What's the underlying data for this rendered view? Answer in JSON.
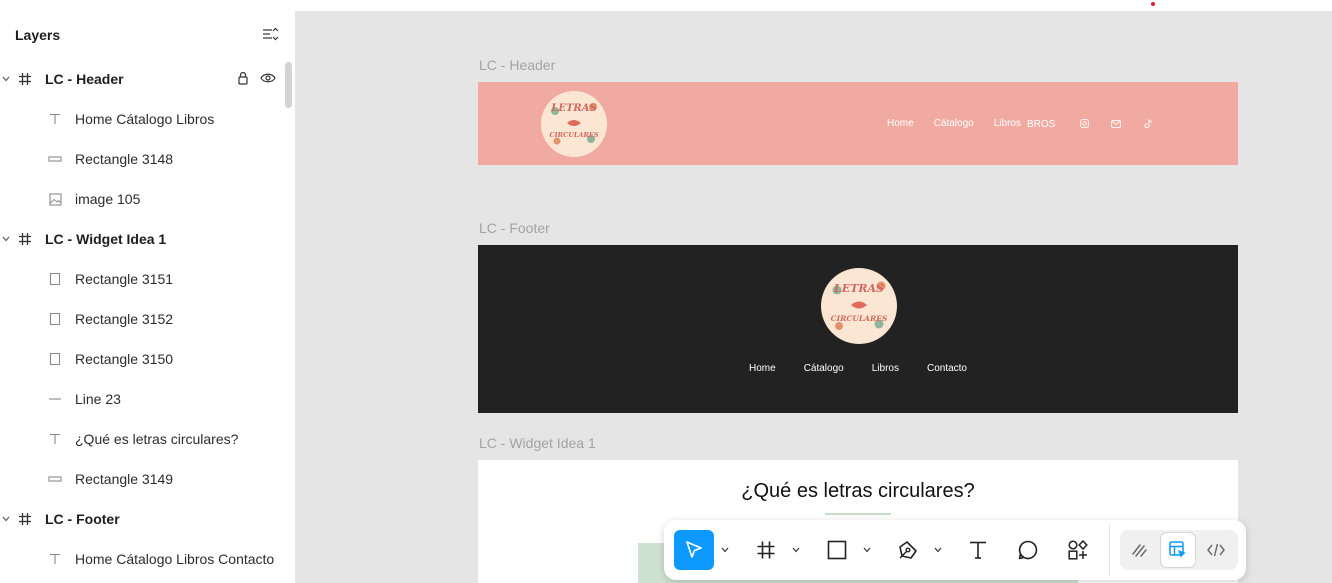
{
  "panel": {
    "title": "Layers",
    "layers": [
      {
        "label": "LC - Header",
        "kind": "frame",
        "icon": "hash-icon"
      },
      {
        "label": "Home Cátalogo Libros",
        "kind": "child",
        "icon": "text-icon"
      },
      {
        "label": "Rectangle 3148",
        "kind": "child",
        "icon": "rectangle-flat-icon"
      },
      {
        "label": "image 105",
        "kind": "child",
        "icon": "image-icon"
      },
      {
        "label": "LC - Widget Idea 1",
        "kind": "frame",
        "icon": "hash-icon"
      },
      {
        "label": "Rectangle 3151",
        "kind": "child",
        "icon": "rectangle-tall-icon"
      },
      {
        "label": "Rectangle 3152",
        "kind": "child",
        "icon": "rectangle-tall-icon"
      },
      {
        "label": "Rectangle 3150",
        "kind": "child",
        "icon": "rectangle-tall-icon"
      },
      {
        "label": "Line 23",
        "kind": "child",
        "icon": "line-icon"
      },
      {
        "label": "¿Qué es letras circulares?",
        "kind": "child",
        "icon": "text-icon"
      },
      {
        "label": "Rectangle 3149",
        "kind": "child",
        "icon": "rectangle-flat-icon"
      },
      {
        "label": "LC - Footer",
        "kind": "frame",
        "icon": "hash-icon"
      },
      {
        "label": "Home Cátalogo Libros Contacto",
        "kind": "child",
        "icon": "text-icon"
      }
    ]
  },
  "canvas": {
    "header_label": "LC - Header",
    "footer_label": "LC - Footer",
    "widget_label": "LC - Widget Idea 1",
    "header_nav": [
      "Home",
      "Cátalogo",
      "Libros",
      "BROS"
    ],
    "footer_nav": [
      "Home",
      "Cátalogo",
      "Libros",
      "Contacto"
    ],
    "logo_text_top": "LETRAS",
    "logo_text_bottom": "CIRCULARES",
    "widget_title": "¿Qué es letras circulares?",
    "colors": {
      "header_bg": "#f1aaa1",
      "footer_bg": "#222222",
      "accent_blue": "#0d99ff",
      "canvas_bg": "#e5e5e5"
    }
  },
  "toolbar": {
    "tools": [
      "move-tool",
      "frame-tool",
      "rectangle-tool",
      "pen-tool",
      "text-tool",
      "comment-tool",
      "assets-tool"
    ],
    "active_tool": "move-tool",
    "modes": [
      "draw-mode",
      "design-mode",
      "dev-mode"
    ],
    "active_mode": "design-mode"
  }
}
